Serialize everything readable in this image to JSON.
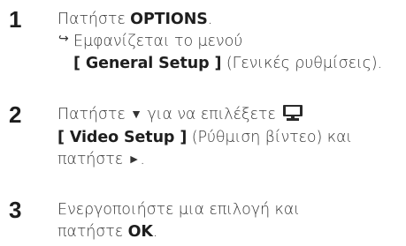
{
  "steps": [
    {
      "number": "1",
      "line1": {
        "text": "Πατήστε ",
        "bold": "OPTIONS",
        "suffix": "."
      },
      "result": {
        "icon": "↪",
        "line1": "Εμφανίζεται το μενού",
        "line2_bold": "[ General Setup ]",
        "line2_rest": " (Γενικές ρυθμίσεις)."
      }
    },
    {
      "number": "2",
      "line1": {
        "text": "Πατήστε ",
        "down_glyph": "▼",
        "middle": " για να επιλέξετε ",
        "icon_name": "monitor-icon"
      },
      "line2": {
        "bold": "[ Video Setup ]",
        "rest": " (Ρύθμιση βίντεο) και"
      },
      "line3": {
        "text": "πατήστε ",
        "right_glyph": "►",
        "suffix": "."
      }
    },
    {
      "number": "3",
      "line1": {
        "text": "Ενεργοποιήστε μια επιλογή και"
      },
      "line2": {
        "text": "πατήστε ",
        "bold": "OK",
        "suffix": "."
      }
    }
  ]
}
